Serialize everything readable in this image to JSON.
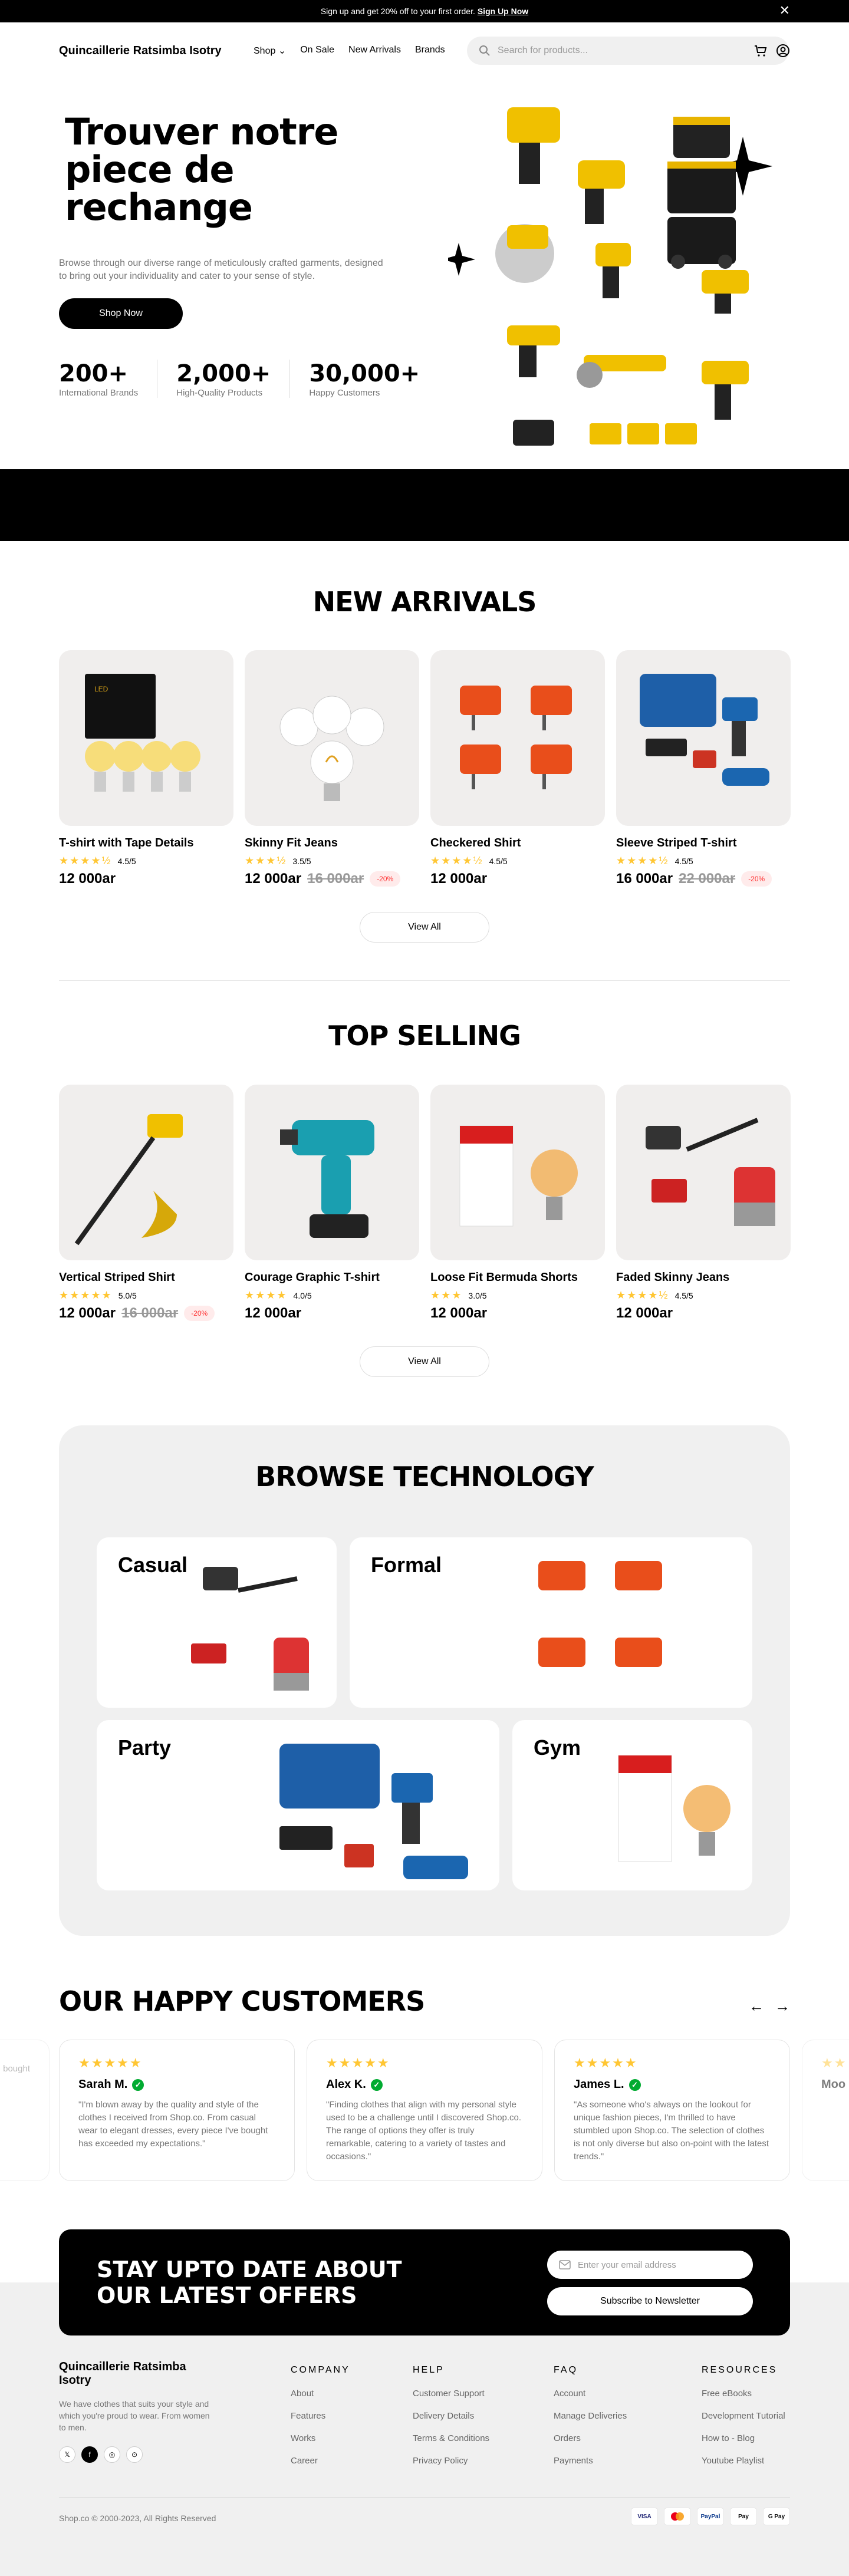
{
  "announcement": {
    "text": "Sign up and get 20% off to your first order.",
    "link": "Sign Up Now"
  },
  "nav": {
    "brand": "Quincaillerie Ratsimba Isotry",
    "menu": [
      "Shop",
      "On Sale",
      "New Arrivals",
      "Brands"
    ],
    "search_placeholder": "Search for products..."
  },
  "hero": {
    "title": "Trouver notre piece de rechange",
    "description": "Browse through our diverse range of meticulously crafted garments, designed to bring out your individuality and cater to your sense of style.",
    "cta": "Shop Now",
    "stats": [
      {
        "n": "200+",
        "l": "International Brands"
      },
      {
        "n": "2,000+",
        "l": "High-Quality Products"
      },
      {
        "n": "30,000+",
        "l": "Happy Customers"
      }
    ]
  },
  "new_arrivals": {
    "title": "NEW ARRIVALS",
    "view_all": "View All",
    "products": [
      {
        "name": "T-shirt with Tape Details",
        "rating": "4.5/5",
        "stars": "★★★★½",
        "price": "12 000ar",
        "old": "",
        "disc": ""
      },
      {
        "name": "Skinny Fit Jeans",
        "rating": "3.5/5",
        "stars": "★★★½",
        "price": "12 000ar",
        "old": "16 000ar",
        "disc": "-20%"
      },
      {
        "name": "Checkered Shirt",
        "rating": "4.5/5",
        "stars": "★★★★½",
        "price": "12 000ar",
        "old": "",
        "disc": ""
      },
      {
        "name": "Sleeve Striped T-shirt",
        "rating": "4.5/5",
        "stars": "★★★★½",
        "price": "16 000ar",
        "old": "22 000ar",
        "disc": "-20%"
      }
    ]
  },
  "top_selling": {
    "title": "TOP SELLING",
    "view_all": "View All",
    "products": [
      {
        "name": "Vertical Striped Shirt",
        "rating": "5.0/5",
        "stars": "★★★★★",
        "price": "12 000ar",
        "old": "16 000ar",
        "disc": "-20%"
      },
      {
        "name": "Courage Graphic T-shirt",
        "rating": "4.0/5",
        "stars": "★★★★",
        "price": "12 000ar",
        "old": "",
        "disc": ""
      },
      {
        "name": "Loose Fit Bermuda Shorts",
        "rating": "3.0/5",
        "stars": "★★★",
        "price": "12 000ar",
        "old": "",
        "disc": ""
      },
      {
        "name": "Faded Skinny Jeans",
        "rating": "4.5/5",
        "stars": "★★★★½",
        "price": "12 000ar",
        "old": "",
        "disc": ""
      }
    ]
  },
  "browse": {
    "title": "BROWSE TECHNOLOGY",
    "categories": [
      "Casual",
      "Formal",
      "Party",
      "Gym"
    ]
  },
  "reviews": {
    "title": "OUR HAPPY CUSTOMERS",
    "items": [
      {
        "name": "Sarah M.",
        "stars": "★★★★★",
        "text": "\"I'm blown away by the quality and style of the clothes I received from Shop.co. From casual wear to elegant dresses, every piece I've bought has exceeded my expectations.\""
      },
      {
        "name": "Alex K.",
        "stars": "★★★★★",
        "text": "\"Finding clothes that align with my personal style used to be a challenge until I discovered Shop.co. The range of options they offer is truly remarkable, catering to a variety of tastes and occasions.\""
      },
      {
        "name": "James L.",
        "stars": "★★★★★",
        "text": "\"As someone who's always on the lookout for unique fashion pieces, I'm thrilled to have stumbled upon Shop.co. The selection of clothes is not only diverse but also on-point with the latest trends.\""
      }
    ],
    "partial_left": "the casual bought",
    "partial_right": "Moo"
  },
  "newsletter": {
    "title": "STAY UPTO DATE ABOUT OUR LATEST OFFERS",
    "placeholder": "Enter your email address",
    "button": "Subscribe to Newsletter"
  },
  "footer": {
    "brand": "Quincaillerie Ratsimba Isotry",
    "desc": "We have clothes that suits your style and which you're proud to wear. From women to men.",
    "cols": [
      {
        "h": "COMPANY",
        "items": [
          "About",
          "Features",
          "Works",
          "Career"
        ]
      },
      {
        "h": "HELP",
        "items": [
          "Customer Support",
          "Delivery Details",
          "Terms & Conditions",
          "Privacy Policy"
        ]
      },
      {
        "h": "FAQ",
        "items": [
          "Account",
          "Manage Deliveries",
          "Orders",
          "Payments"
        ]
      },
      {
        "h": "RESOURCES",
        "items": [
          "Free eBooks",
          "Development Tutorial",
          "How to - Blog",
          "Youtube Playlist"
        ]
      }
    ],
    "copyright": "Shop.co © 2000-2023, All Rights Reserved",
    "payments": [
      "VISA",
      "MC",
      "PayPal",
      "Pay",
      "G Pay"
    ]
  }
}
